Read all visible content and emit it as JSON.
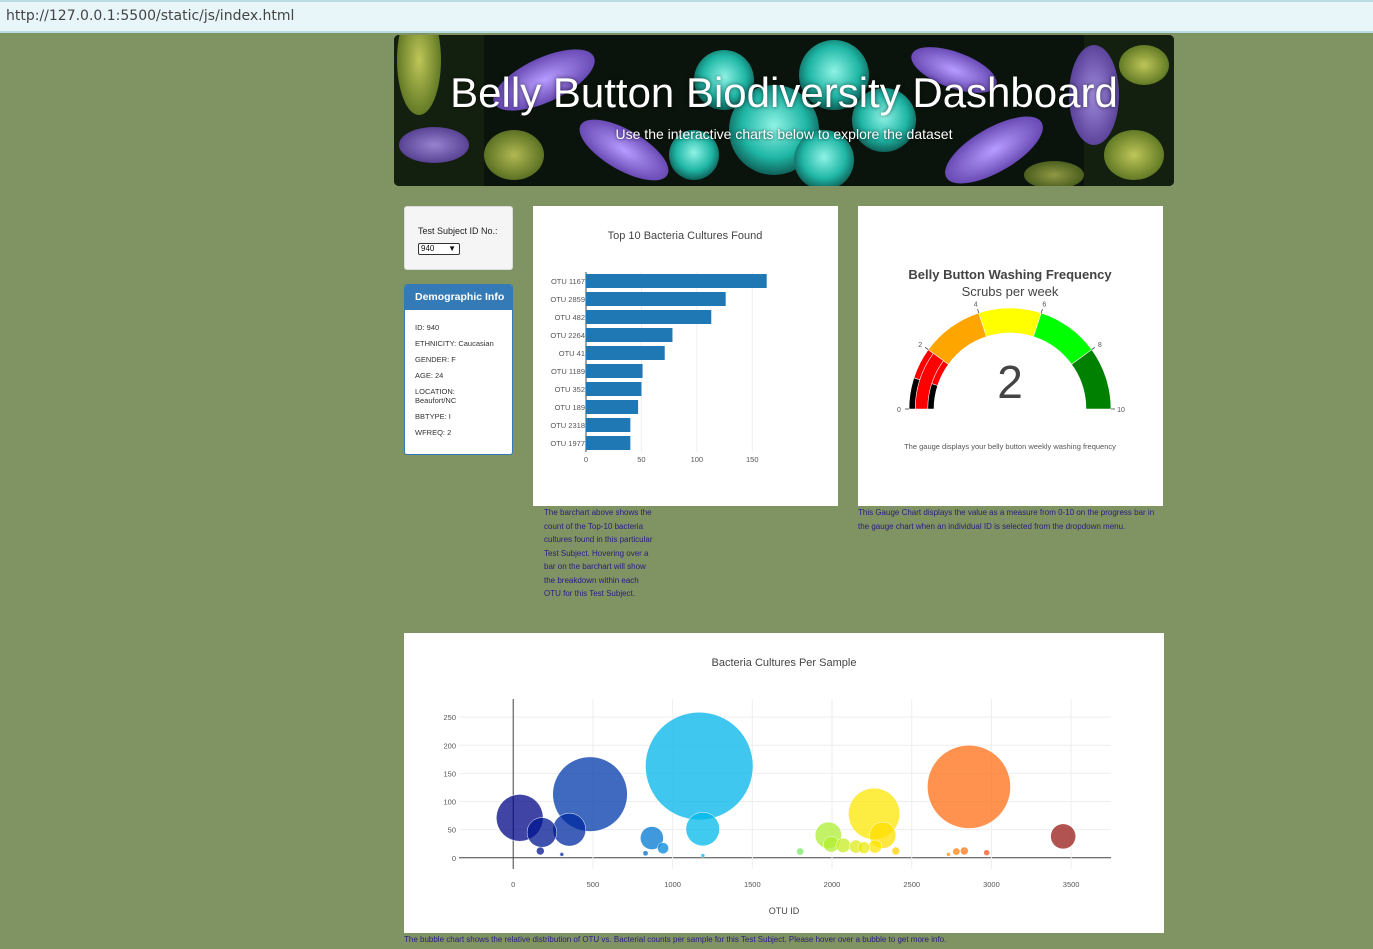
{
  "browser": {
    "url": "http://127.0.0.1:5500/static/js/index.html"
  },
  "header": {
    "title": "Belly Button Biodiversity Dashboard",
    "subtitle": "Use the interactive charts below to explore the dataset"
  },
  "selector": {
    "label": "Test Subject ID No.:",
    "selected": "940"
  },
  "demographics": {
    "title": "Demographic Info",
    "rows": [
      "ID: 940",
      "ETHNICITY: Caucasian",
      "GENDER: F",
      "AGE: 24",
      "LOCATION: Beaufort/NC",
      "BBTYPE: I",
      "WFREQ: 2"
    ]
  },
  "captions": {
    "bar": "The barchart above shows the count of the Top-10 bacteria cultures found in this particular Test Subject. Hovering over a bar on the barchart will show the breakdown within each OTU for this Test Subject.",
    "gauge": "This Gauge Chart displays the value as a measure from 0-10 on the progress bar in the gauge chart when an individual ID is selected from the dropdown menu.",
    "bubble": "The bubble chart shows the relative distribution of OTU vs. Bacterial counts per sample for this Test Subject. Please hover over a bubble to get more info."
  },
  "colors": {
    "bar": "#1f77b4",
    "panel_header": "#337ab7",
    "page_bg": "#7f9462",
    "caption_text": "#2c1a86"
  },
  "chart_data": [
    {
      "type": "bar",
      "orientation": "horizontal",
      "title": "Top 10 Bacteria Cultures Found",
      "categories": [
        "OTU 1167",
        "OTU 2859",
        "OTU 482",
        "OTU 2264",
        "OTU 41",
        "OTU 1189",
        "OTU 352",
        "OTU 189",
        "OTU 2318",
        "OTU 1977"
      ],
      "values": [
        163,
        126,
        113,
        78,
        71,
        51,
        50,
        47,
        40,
        40
      ],
      "xlim": [
        0,
        175
      ],
      "xticks": [
        0,
        50,
        100,
        150
      ]
    },
    {
      "type": "gauge",
      "title": "Belly Button Washing Frequency",
      "subtitle": "Scrubs per week",
      "value": 2,
      "range": [
        0,
        10
      ],
      "ticks": [
        0,
        2,
        4,
        6,
        8,
        10
      ],
      "steps": [
        {
          "range": [
            0,
            1
          ],
          "color": "#000000"
        },
        {
          "range": [
            1,
            2
          ],
          "color": "#ff0000"
        },
        {
          "range": [
            2,
            4
          ],
          "color": "#ffa500"
        },
        {
          "range": [
            4,
            6
          ],
          "color": "#ffff00"
        },
        {
          "range": [
            6,
            8
          ],
          "color": "#00ff00"
        },
        {
          "range": [
            8,
            10
          ],
          "color": "#008000"
        }
      ],
      "bar_color": "#ff0000",
      "note": "The gauge displays your belly button weekly washing frequency"
    },
    {
      "type": "scatter",
      "title": "Bacteria Cultures Per Sample",
      "xlabel": "OTU ID",
      "xlim": [
        -340,
        3750
      ],
      "ylim": [
        -20,
        300
      ],
      "xticks": [
        0,
        500,
        1000,
        1500,
        2000,
        2500,
        3000,
        3500
      ],
      "yticks": [
        0,
        50,
        100,
        150,
        200,
        250
      ],
      "points": [
        {
          "x": 41,
          "y": 71
        },
        {
          "x": 180,
          "y": 45
        },
        {
          "x": 352,
          "y": 50
        },
        {
          "x": 482,
          "y": 113
        },
        {
          "x": 170,
          "y": 12
        },
        {
          "x": 305,
          "y": 6
        },
        {
          "x": 870,
          "y": 35
        },
        {
          "x": 940,
          "y": 17
        },
        {
          "x": 830,
          "y": 8
        },
        {
          "x": 1167,
          "y": 163
        },
        {
          "x": 1189,
          "y": 51
        },
        {
          "x": 1190,
          "y": 4
        },
        {
          "x": 1800,
          "y": 11
        },
        {
          "x": 1977,
          "y": 40
        },
        {
          "x": 1995,
          "y": 24
        },
        {
          "x": 2070,
          "y": 22
        },
        {
          "x": 2150,
          "y": 20
        },
        {
          "x": 2264,
          "y": 78
        },
        {
          "x": 2318,
          "y": 40
        },
        {
          "x": 2200,
          "y": 18
        },
        {
          "x": 2270,
          "y": 20
        },
        {
          "x": 2400,
          "y": 12
        },
        {
          "x": 2859,
          "y": 126
        },
        {
          "x": 2730,
          "y": 6
        },
        {
          "x": 2780,
          "y": 11
        },
        {
          "x": 2830,
          "y": 12
        },
        {
          "x": 2970,
          "y": 9
        },
        {
          "x": 3450,
          "y": 38
        }
      ]
    }
  ]
}
